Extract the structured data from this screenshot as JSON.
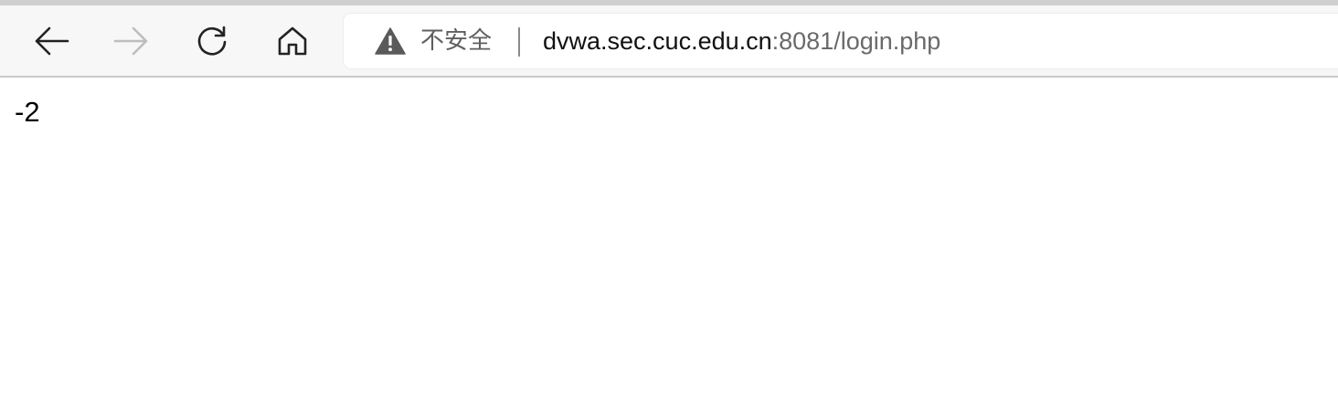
{
  "browser": {
    "toolbar": {
      "back_icon": "arrow-left-icon",
      "forward_icon": "arrow-right-icon",
      "forward_enabled": false,
      "reload_icon": "reload-icon",
      "home_icon": "home-icon"
    },
    "address_bar": {
      "security_icon": "warning-triangle-icon",
      "security_label": "不安全",
      "url_host": "dvwa.sec.cuc.edu.cn",
      "url_rest": ":8081/login.php"
    }
  },
  "page": {
    "body_text": "-2"
  },
  "colors": {
    "toolbar_bg": "#f7f7f7",
    "address_bg": "#ffffff",
    "icon_active": "#222222",
    "icon_disabled": "#bdbdbd",
    "security_text": "#5f5f5f",
    "url_host": "#111111",
    "url_rest": "#6a6a6a"
  }
}
